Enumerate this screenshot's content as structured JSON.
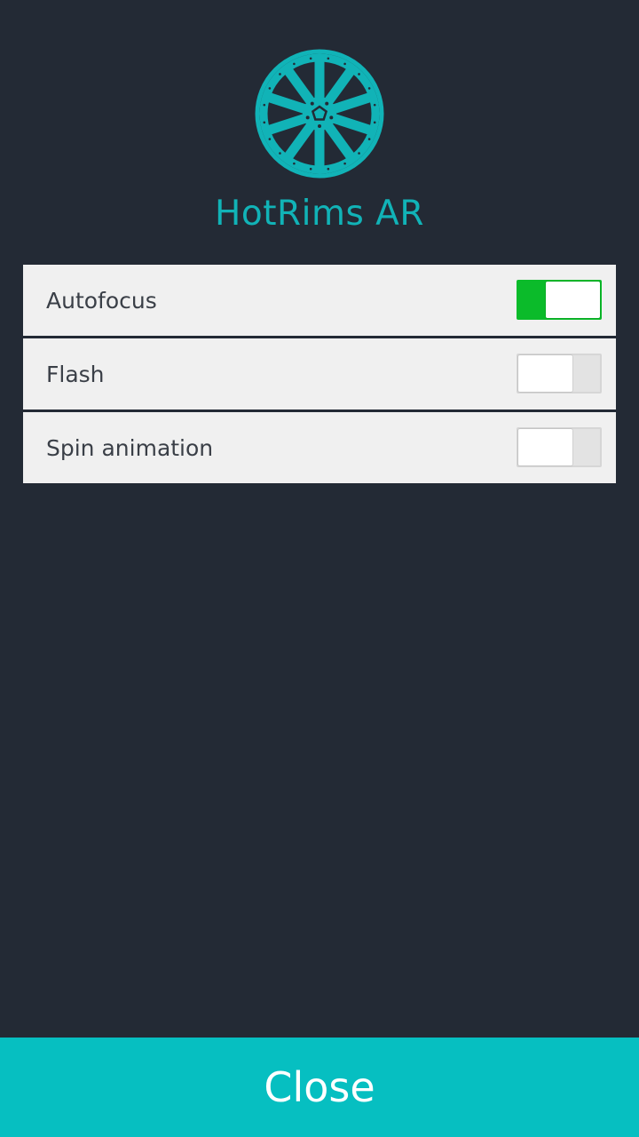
{
  "app": {
    "title": "HotRims AR",
    "logo_icon": "wheel-rim-icon",
    "accent_color": "#11b3b7"
  },
  "settings": [
    {
      "label": "Autofocus",
      "enabled": true
    },
    {
      "label": "Flash",
      "enabled": false
    },
    {
      "label": "Spin animation",
      "enabled": false
    }
  ],
  "colors": {
    "background": "#232a35",
    "toggle_on": "#0bbb2a",
    "toggle_off": "#e3e3e3",
    "close_button": "#06bfc1"
  },
  "footer": {
    "close_label": "Close"
  }
}
